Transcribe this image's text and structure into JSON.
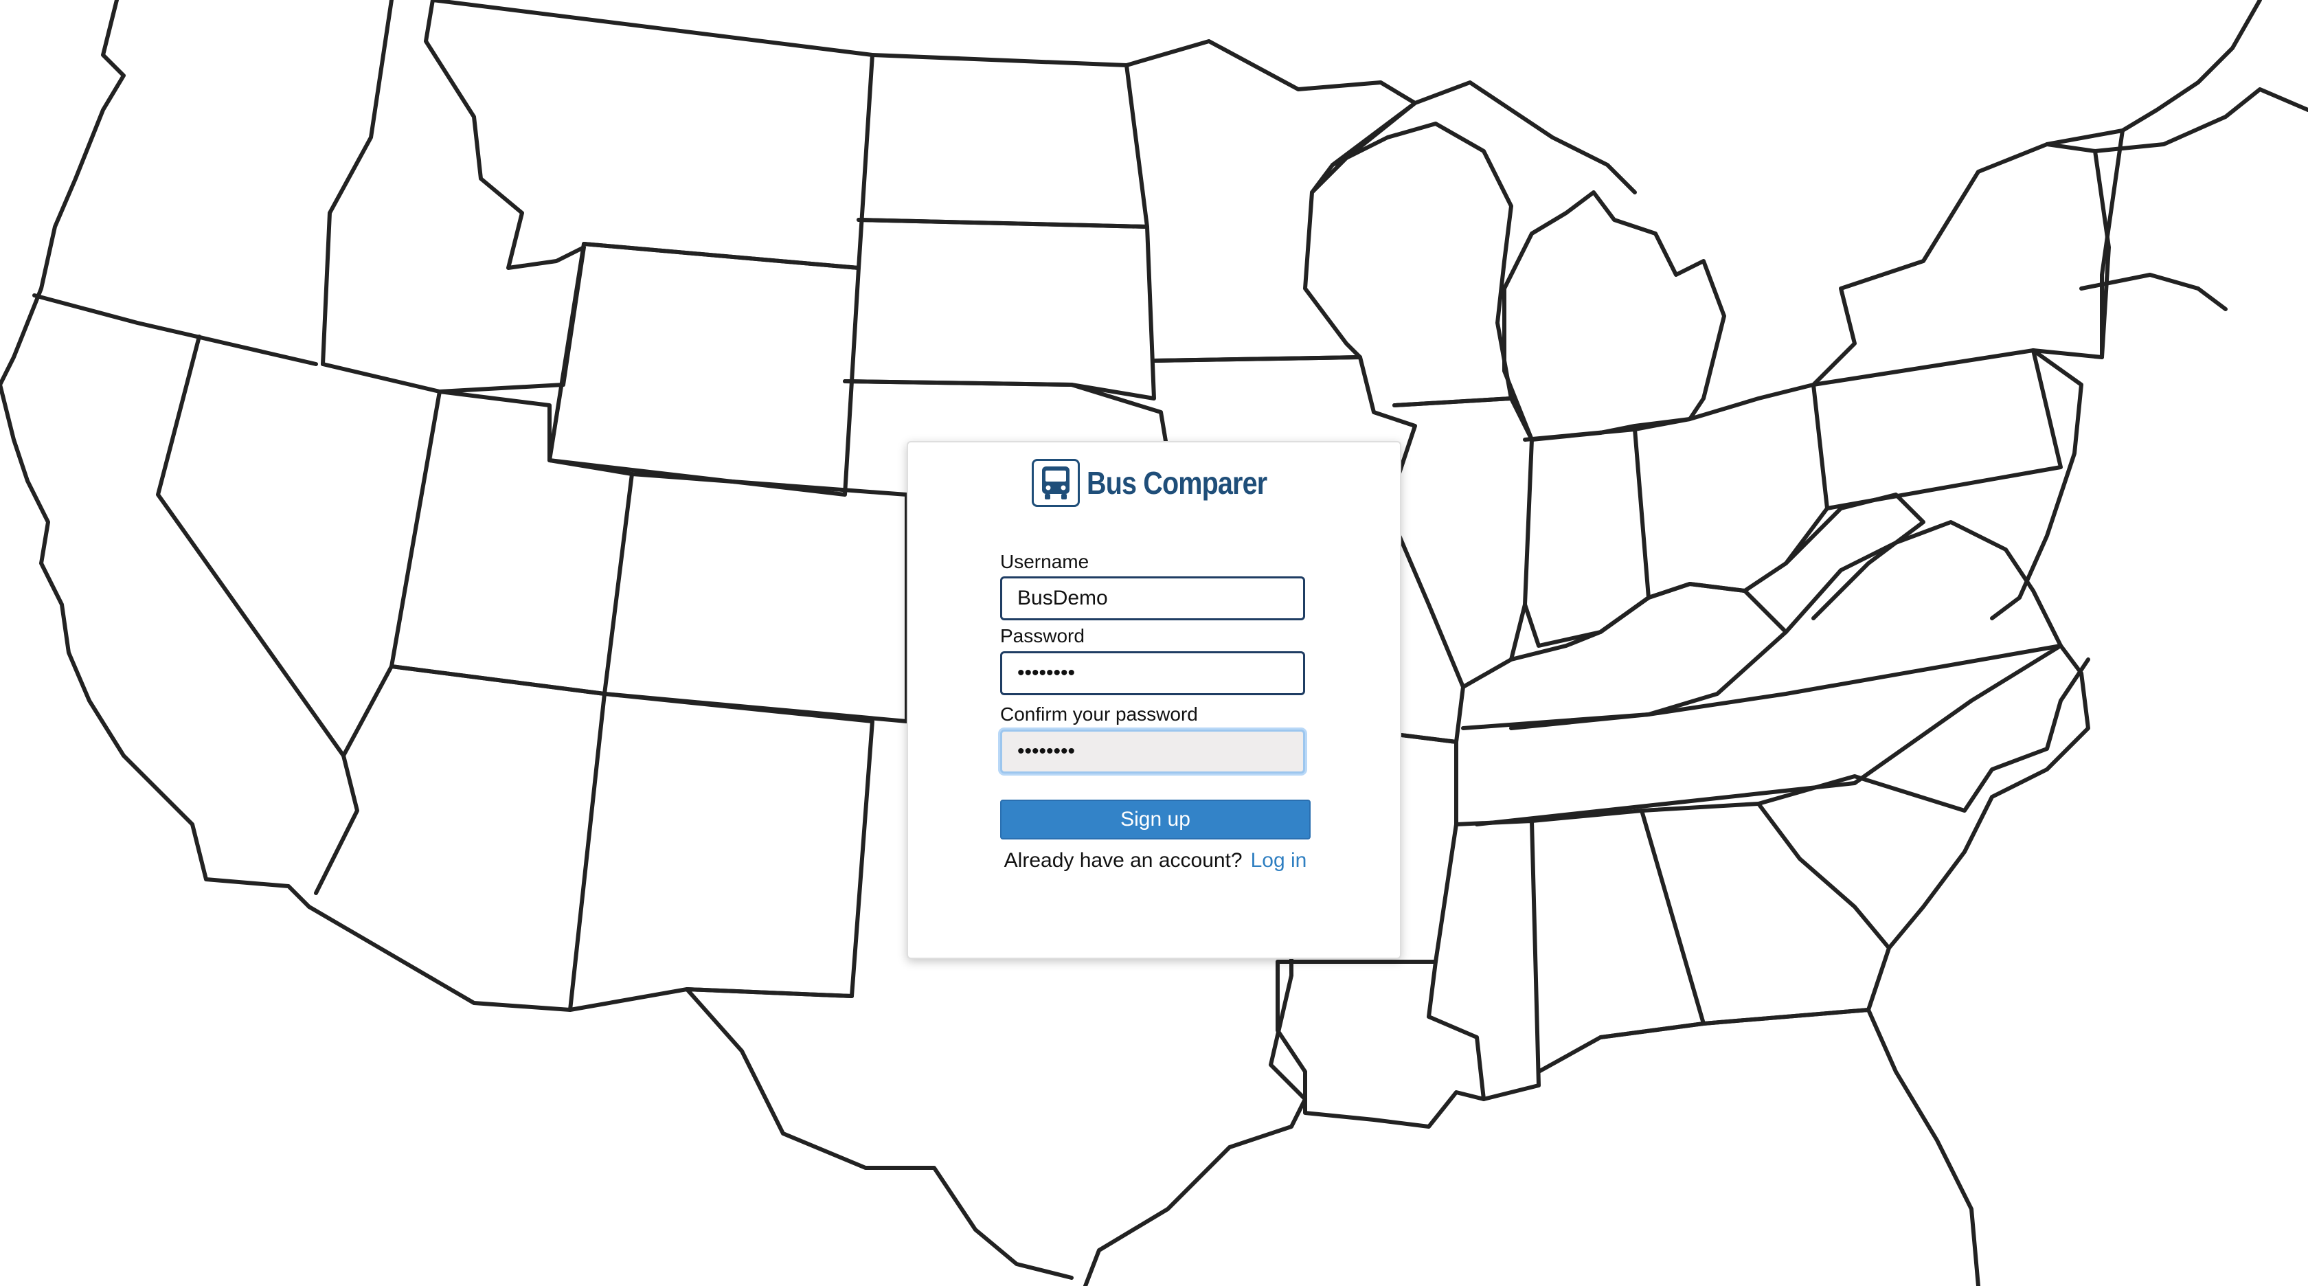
{
  "brand": {
    "name": "Bus Comparer",
    "icon": "bus-icon",
    "color": "#1f4e79"
  },
  "form": {
    "username_label": "Username",
    "username_value": "BusDemo",
    "password_label": "Password",
    "password_value": "••••••••",
    "confirm_label": "Confirm your password",
    "confirm_value": "••••••••",
    "submit_label": "Sign up",
    "submit_color": "#3383c8"
  },
  "footer": {
    "prompt": "Already have an account?",
    "login_link": "Log in",
    "link_color": "#2f7fc1"
  }
}
